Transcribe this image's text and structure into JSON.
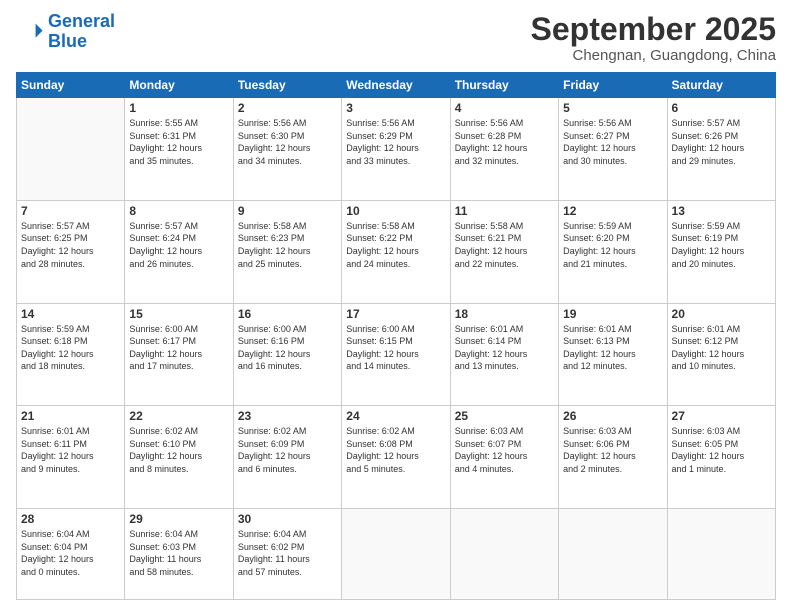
{
  "logo": {
    "line1": "General",
    "line2": "Blue"
  },
  "title": "September 2025",
  "subtitle": "Chengnan, Guangdong, China",
  "weekdays": [
    "Sunday",
    "Monday",
    "Tuesday",
    "Wednesday",
    "Thursday",
    "Friday",
    "Saturday"
  ],
  "weeks": [
    [
      {
        "day": "",
        "info": ""
      },
      {
        "day": "1",
        "info": "Sunrise: 5:55 AM\nSunset: 6:31 PM\nDaylight: 12 hours\nand 35 minutes."
      },
      {
        "day": "2",
        "info": "Sunrise: 5:56 AM\nSunset: 6:30 PM\nDaylight: 12 hours\nand 34 minutes."
      },
      {
        "day": "3",
        "info": "Sunrise: 5:56 AM\nSunset: 6:29 PM\nDaylight: 12 hours\nand 33 minutes."
      },
      {
        "day": "4",
        "info": "Sunrise: 5:56 AM\nSunset: 6:28 PM\nDaylight: 12 hours\nand 32 minutes."
      },
      {
        "day": "5",
        "info": "Sunrise: 5:56 AM\nSunset: 6:27 PM\nDaylight: 12 hours\nand 30 minutes."
      },
      {
        "day": "6",
        "info": "Sunrise: 5:57 AM\nSunset: 6:26 PM\nDaylight: 12 hours\nand 29 minutes."
      }
    ],
    [
      {
        "day": "7",
        "info": "Sunrise: 5:57 AM\nSunset: 6:25 PM\nDaylight: 12 hours\nand 28 minutes."
      },
      {
        "day": "8",
        "info": "Sunrise: 5:57 AM\nSunset: 6:24 PM\nDaylight: 12 hours\nand 26 minutes."
      },
      {
        "day": "9",
        "info": "Sunrise: 5:58 AM\nSunset: 6:23 PM\nDaylight: 12 hours\nand 25 minutes."
      },
      {
        "day": "10",
        "info": "Sunrise: 5:58 AM\nSunset: 6:22 PM\nDaylight: 12 hours\nand 24 minutes."
      },
      {
        "day": "11",
        "info": "Sunrise: 5:58 AM\nSunset: 6:21 PM\nDaylight: 12 hours\nand 22 minutes."
      },
      {
        "day": "12",
        "info": "Sunrise: 5:59 AM\nSunset: 6:20 PM\nDaylight: 12 hours\nand 21 minutes."
      },
      {
        "day": "13",
        "info": "Sunrise: 5:59 AM\nSunset: 6:19 PM\nDaylight: 12 hours\nand 20 minutes."
      }
    ],
    [
      {
        "day": "14",
        "info": "Sunrise: 5:59 AM\nSunset: 6:18 PM\nDaylight: 12 hours\nand 18 minutes."
      },
      {
        "day": "15",
        "info": "Sunrise: 6:00 AM\nSunset: 6:17 PM\nDaylight: 12 hours\nand 17 minutes."
      },
      {
        "day": "16",
        "info": "Sunrise: 6:00 AM\nSunset: 6:16 PM\nDaylight: 12 hours\nand 16 minutes."
      },
      {
        "day": "17",
        "info": "Sunrise: 6:00 AM\nSunset: 6:15 PM\nDaylight: 12 hours\nand 14 minutes."
      },
      {
        "day": "18",
        "info": "Sunrise: 6:01 AM\nSunset: 6:14 PM\nDaylight: 12 hours\nand 13 minutes."
      },
      {
        "day": "19",
        "info": "Sunrise: 6:01 AM\nSunset: 6:13 PM\nDaylight: 12 hours\nand 12 minutes."
      },
      {
        "day": "20",
        "info": "Sunrise: 6:01 AM\nSunset: 6:12 PM\nDaylight: 12 hours\nand 10 minutes."
      }
    ],
    [
      {
        "day": "21",
        "info": "Sunrise: 6:01 AM\nSunset: 6:11 PM\nDaylight: 12 hours\nand 9 minutes."
      },
      {
        "day": "22",
        "info": "Sunrise: 6:02 AM\nSunset: 6:10 PM\nDaylight: 12 hours\nand 8 minutes."
      },
      {
        "day": "23",
        "info": "Sunrise: 6:02 AM\nSunset: 6:09 PM\nDaylight: 12 hours\nand 6 minutes."
      },
      {
        "day": "24",
        "info": "Sunrise: 6:02 AM\nSunset: 6:08 PM\nDaylight: 12 hours\nand 5 minutes."
      },
      {
        "day": "25",
        "info": "Sunrise: 6:03 AM\nSunset: 6:07 PM\nDaylight: 12 hours\nand 4 minutes."
      },
      {
        "day": "26",
        "info": "Sunrise: 6:03 AM\nSunset: 6:06 PM\nDaylight: 12 hours\nand 2 minutes."
      },
      {
        "day": "27",
        "info": "Sunrise: 6:03 AM\nSunset: 6:05 PM\nDaylight: 12 hours\nand 1 minute."
      }
    ],
    [
      {
        "day": "28",
        "info": "Sunrise: 6:04 AM\nSunset: 6:04 PM\nDaylight: 12 hours\nand 0 minutes."
      },
      {
        "day": "29",
        "info": "Sunrise: 6:04 AM\nSunset: 6:03 PM\nDaylight: 11 hours\nand 58 minutes."
      },
      {
        "day": "30",
        "info": "Sunrise: 6:04 AM\nSunset: 6:02 PM\nDaylight: 11 hours\nand 57 minutes."
      },
      {
        "day": "",
        "info": ""
      },
      {
        "day": "",
        "info": ""
      },
      {
        "day": "",
        "info": ""
      },
      {
        "day": "",
        "info": ""
      }
    ]
  ]
}
